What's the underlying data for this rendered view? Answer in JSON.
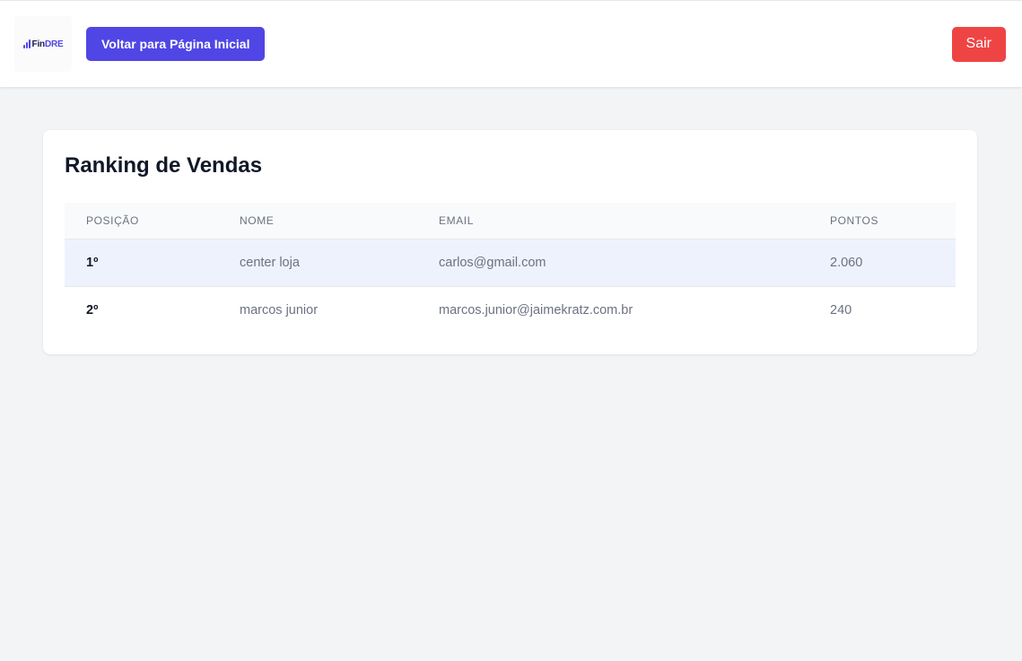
{
  "header": {
    "logo": {
      "prefix": "Fin",
      "suffix": "DRE",
      "icon": "bar-chart-icon",
      "accent_color": "#4f46e5"
    },
    "home_button_label": "Voltar para Página Inicial",
    "exit_button_label": "Sair"
  },
  "ranking": {
    "title": "Ranking de Vendas",
    "columns": [
      "POSIÇÃO",
      "NOME",
      "EMAIL",
      "PONTOS"
    ],
    "rows": [
      {
        "position": "1º",
        "name": "center loja",
        "email": "carlos@gmail.com",
        "points": "2.060"
      },
      {
        "position": "2º",
        "name": "marcos junior",
        "email": "marcos.junior@jaimekratz.com.br",
        "points": "240"
      }
    ]
  },
  "colors": {
    "primary": "#4f46e5",
    "danger": "#ef4444",
    "highlight_row": "#eef2fc"
  }
}
